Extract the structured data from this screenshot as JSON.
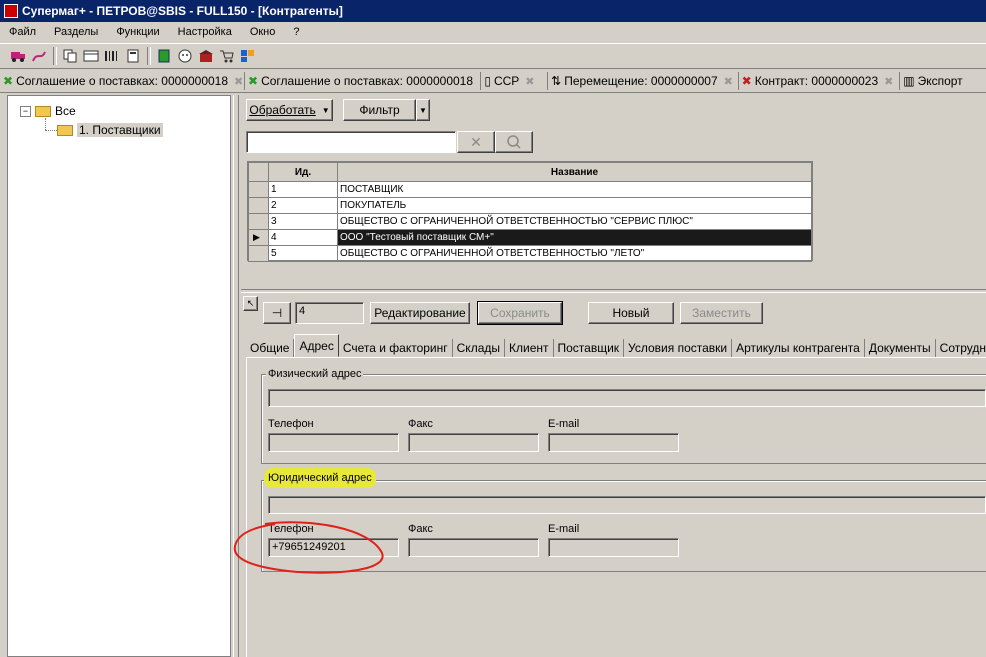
{
  "window": {
    "title": "Супермаг+ - ПЕТРОВ@SBIS - FULL150 - [Контрагенты]"
  },
  "menu": [
    "Файл",
    "Разделы",
    "Функции",
    "Настройка",
    "Окно",
    "?"
  ],
  "toolbar_icons": [
    "truck-icon",
    "route-icon",
    "copy-icon",
    "windows-icon",
    "barcode-icon",
    "calculator-icon",
    "green-doc-icon",
    "face-icon",
    "store-icon",
    "cart-icon",
    "blocks-icon"
  ],
  "doc_tabs": [
    {
      "label": "Соглашение о поставках: 0000000018",
      "icon": "agreement-icon"
    },
    {
      "label": "Соглашение о поставках: 0000000018",
      "icon": "agreement-icon"
    },
    {
      "label": "ССР",
      "icon": "page-icon"
    },
    {
      "label": "Перемещение: 0000000007",
      "icon": "move-icon"
    },
    {
      "label": "Контракт: 0000000023",
      "icon": "contract-icon"
    },
    {
      "label": "Экспорт",
      "icon": "export-icon"
    }
  ],
  "tree": {
    "root": "Все",
    "child": "1. Поставщики"
  },
  "actions": {
    "process": "Обработать",
    "filter": "Фильтр"
  },
  "grid": {
    "headers": [
      "Ид.",
      "Название"
    ],
    "rows": [
      {
        "id": "1",
        "name": "ПОСТАВЩИК"
      },
      {
        "id": "2",
        "name": "ПОКУПАТЕЛЬ"
      },
      {
        "id": "3",
        "name": "ОБЩЕСТВО С ОГРАНИЧЕННОЙ ОТВЕТСТВЕННОСТЬЮ \"СЕРВИС ПЛЮС\""
      },
      {
        "id": "4",
        "name": "ООО \"Тестовый поставщик СМ+\""
      },
      {
        "id": "5",
        "name": "ОБЩЕСТВО С ОГРАНИЧЕННОЙ ОТВЕТСТВЕННОСТЬЮ \"ЛЕТО\""
      }
    ]
  },
  "record": {
    "id_value": "4",
    "edit": "Редактирование",
    "save": "Сохранить",
    "new": "Новый",
    "replace": "Заместить"
  },
  "tabs": [
    "Общие",
    "Адрес",
    "Счета и факторинг",
    "Склады",
    "Клиент",
    "Поставщик",
    "Условия поставки",
    "Артикулы контрагента",
    "Документы",
    "Сотрудники"
  ],
  "physical": {
    "title": "Физический адрес",
    "phone_label": "Телефон",
    "fax_label": "Факс",
    "email_label": "E-mail",
    "phone": "",
    "fax": "",
    "email": ""
  },
  "legal": {
    "title": "Юридический адрес",
    "phone_label": "Телефон",
    "fax_label": "Факс",
    "email_label": "E-mail",
    "phone": "+79651249201",
    "fax": "",
    "email": ""
  },
  "colors": {
    "titlebar": "#0a246a",
    "highlight": "#e8e83a",
    "annotation": "#e0201a"
  }
}
